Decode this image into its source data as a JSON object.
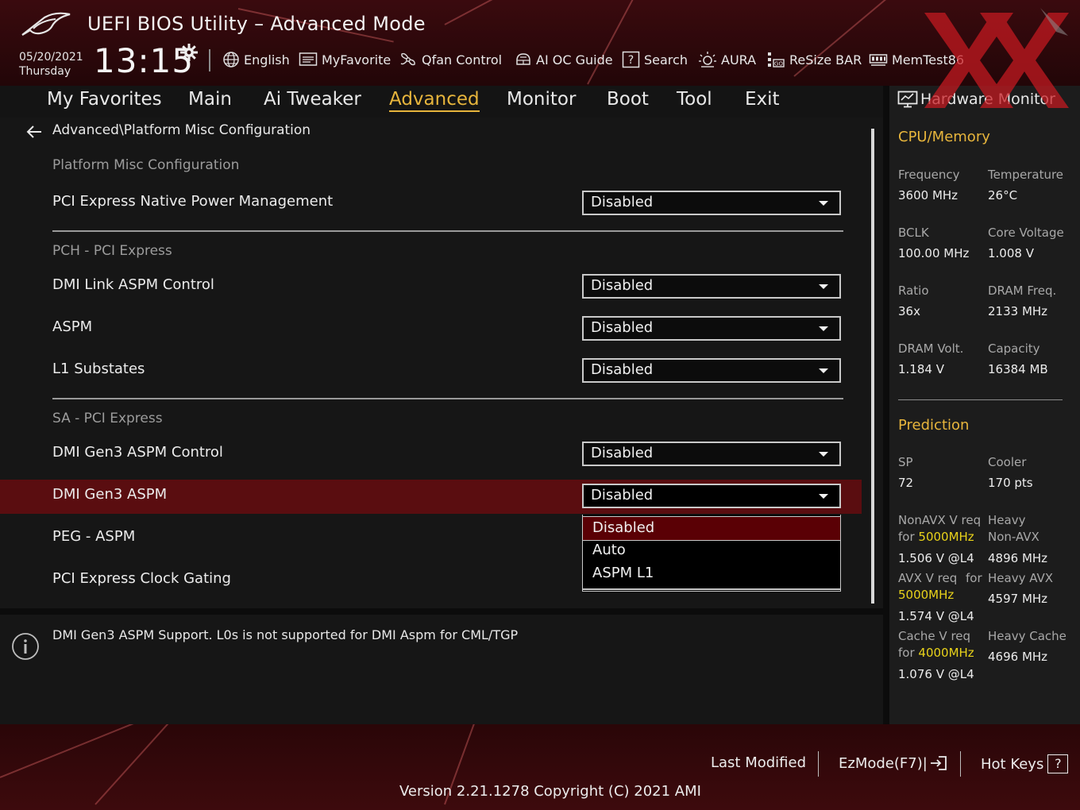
{
  "header": {
    "title": "UEFI BIOS Utility – Advanced Mode",
    "date": "05/20/2021",
    "day": "Thursday",
    "time": "13:15",
    "toolbar": [
      {
        "label": "English",
        "icon": "globe-icon"
      },
      {
        "label": "MyFavorite",
        "icon": "favorite-list-icon"
      },
      {
        "label": "Qfan Control",
        "icon": "fan-icon"
      },
      {
        "label": "AI OC Guide",
        "icon": "ai-chip-icon"
      },
      {
        "label": "Search",
        "icon": "help-search-icon"
      },
      {
        "label": "AURA",
        "icon": "aura-light-icon"
      },
      {
        "label": "ReSize BAR",
        "icon": "resize-bar-icon"
      },
      {
        "label": "MemTest86",
        "icon": "memtest-icon"
      }
    ]
  },
  "tabs": [
    "My Favorites",
    "Main",
    "Ai Tweaker",
    "Advanced",
    "Monitor",
    "Boot",
    "Tool",
    "Exit"
  ],
  "active_tab": "Advanced",
  "breadcrumb": "Advanced\\Platform Misc Configuration",
  "sections": [
    {
      "title": "Platform Misc Configuration",
      "rows": [
        {
          "label": "PCI Express Native Power Management",
          "value": "Disabled"
        }
      ]
    },
    {
      "title": "PCH - PCI Express",
      "rows": [
        {
          "label": "DMI Link ASPM Control",
          "value": "Disabled"
        },
        {
          "label": "ASPM",
          "value": "Disabled"
        },
        {
          "label": "L1 Substates",
          "value": "Disabled"
        }
      ]
    },
    {
      "title": "SA - PCI Express",
      "rows": [
        {
          "label": "DMI Gen3 ASPM Control",
          "value": "Disabled"
        },
        {
          "label": "DMI Gen3 ASPM",
          "value": "Disabled"
        },
        {
          "label": "PEG - ASPM",
          "value": ""
        },
        {
          "label": "PCI Express Clock Gating",
          "value": ""
        }
      ]
    }
  ],
  "dropdown_options": [
    "Disabled",
    "Auto",
    "ASPM L1"
  ],
  "help_text": "DMI Gen3 ASPM Support.  L0s is not supported for DMI Aspm for CML/TGP",
  "hardware_monitor": {
    "title": "Hardware Monitor",
    "cpu_memory": {
      "title": "CPU/Memory",
      "items": [
        {
          "label": "Frequency",
          "value": "3600 MHz"
        },
        {
          "label": "Temperature",
          "value": "26°C"
        },
        {
          "label": "BCLK",
          "value": "100.00 MHz"
        },
        {
          "label": "Core Voltage",
          "value": "1.008 V"
        },
        {
          "label": "Ratio",
          "value": "36x"
        },
        {
          "label": "DRAM Freq.",
          "value": "2133 MHz"
        },
        {
          "label": "DRAM Volt.",
          "value": "1.184 V"
        },
        {
          "label": "Capacity",
          "value": "16384 MB"
        }
      ]
    },
    "prediction": {
      "title": "Prediction",
      "sp_label": "SP",
      "sp_value": "72",
      "cooler_label": "Cooler",
      "cooler_value": "170 pts",
      "nonavx_label": "NonAVX V req",
      "for_label": "for",
      "nonavx_freq": "5000MHz",
      "nonavx_value": "1.506 V @L4",
      "heavy_label": "Heavy",
      "nonavx_heavy_label": "Non-AVX",
      "nonavx_heavy_value": "4896 MHz",
      "avx_label": "AVX V req",
      "avx_for_label": "for",
      "avx_freq": "5000MHz",
      "avx_value": "1.574 V @L4",
      "heavy_avx_label": "Heavy AVX",
      "heavy_avx_value": "4597 MHz",
      "cache_label": "Cache V req",
      "cache_for_label": "for",
      "cache_freq": "4000MHz",
      "cache_value": "1.076 V @L4",
      "heavy_cache_label": "Heavy Cache",
      "heavy_cache_value": "4696 MHz"
    }
  },
  "footer": {
    "last_modified": "Last Modified",
    "ezmode": "EzMode(F7)|",
    "hot_keys": "Hot Keys",
    "hot_keys_badge": "?",
    "version": "Version 2.21.1278 Copyright (C) 2021 AMI"
  },
  "colors": {
    "accent": "#e7b53c",
    "highlight_row": "#5a0d10",
    "selected_option": "#5a0005",
    "prediction_freq": "#e8d21a"
  }
}
